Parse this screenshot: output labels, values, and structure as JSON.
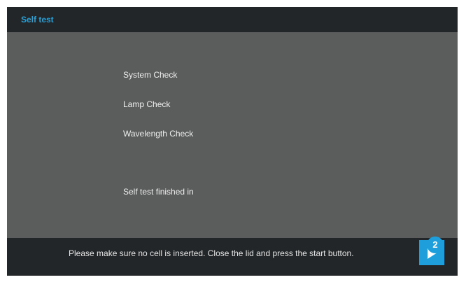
{
  "window": {
    "title": "Self test"
  },
  "checks": {
    "items": [
      {
        "label": "System Check"
      },
      {
        "label": "Lamp Check"
      },
      {
        "label": "Wavelength Check"
      }
    ],
    "finished_label": "Self test finished in"
  },
  "footer": {
    "message": "Please make sure no cell is inserted. Close the lid and press the start button.",
    "start_button_icon": "play-icon"
  },
  "callout": {
    "step_number": "2"
  },
  "colors": {
    "accent": "#1e9fdb",
    "title_bar": "#232628",
    "panel": "#5b5d5c",
    "text": "#eeeeee"
  }
}
